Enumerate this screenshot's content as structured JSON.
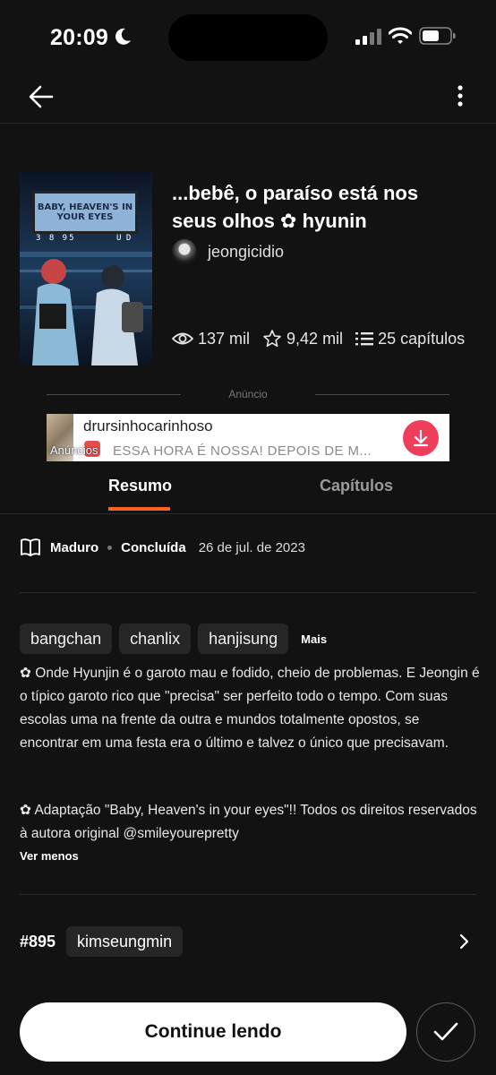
{
  "status_bar": {
    "time": "20:09"
  },
  "nav": {
    "back_icon": "arrow-left-icon",
    "more_icon": "vertical-dots-icon"
  },
  "story": {
    "title": "...bebê, o paraíso está nos seus olhos ✿ hyunin",
    "author": "jeongicidio",
    "cover_text": {
      "sign": "BABY, HEAVEN'S IN YOUR EYES",
      "digits": "3  8  95",
      "code": "U D"
    },
    "stats": {
      "reads": "137 mil",
      "votes": "9,42 mil",
      "parts": "25 capítulos"
    }
  },
  "ad": {
    "label": "Anúncio",
    "advertiser": "drursinhocarinhoso",
    "badge": "Anúncios",
    "text": "ESSA HORA É NOSSA! DEPOIS DE M...",
    "accent_color": "#ef3e5c"
  },
  "tabs": [
    {
      "label": "Resumo",
      "active": true
    },
    {
      "label": "Capítulos",
      "active": false
    }
  ],
  "accent_color": "#ff6122",
  "meta": {
    "rating": "Maduro",
    "status": "Concluída",
    "date": "26 de jul. de 2023"
  },
  "tags": [
    "bangchan",
    "chanlix",
    "hanjisung"
  ],
  "tags_more": "Mais",
  "description": [
    "✿ Onde Hyunjin é o garoto mau e fodido, cheio de problemas. E Jeongin é o típico garoto rico que \"precisa\" ser perfeito todo o tempo. Com suas escolas uma na frente da outra e mundos totalmente opostos, se encontrar em uma festa era o último e talvez o único que precisavam.",
    "✿ Adaptação \"Baby, Heaven's in your eyes\"!!   Todos os direitos reservados à autora original @smileyourepretty"
  ],
  "ver_menos": "Ver menos",
  "ranking": {
    "number": "#895",
    "tag": "kimseungmin"
  },
  "actions": {
    "continue_label": "Continue lendo"
  }
}
